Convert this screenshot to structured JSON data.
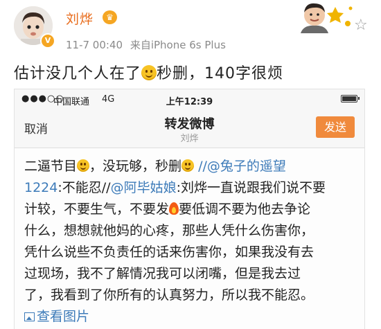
{
  "post": {
    "username": "刘烨",
    "timestamp": "11-7 00:40",
    "source": "来自iPhone 6s Plus",
    "headline_before": "估计没几个人在了",
    "headline_after": "秒删，140字很烦"
  },
  "statusbar": {
    "carrier": "中国联通",
    "network": "4G",
    "time": "上午12:39"
  },
  "navbar": {
    "cancel": "取消",
    "title": "转发微博",
    "subtitle": "刘烨",
    "send": "发送"
  },
  "repost": {
    "l1_a": "二逼节目",
    "l1_b": "，没玩够，秒删",
    "l1_link": "//@兔子的遥望",
    "l2_link1": "1224",
    "l2_a": ":不能忍//",
    "l2_link2": "@阿毕姑娘",
    "l2_b": ":刘烨一直说跟我们说不要",
    "l3_a": "计较，不要生气，不要发",
    "l3_b": "要低调不要为他去争论",
    "l4": "什么，想想就他妈的心疼，那些人凭什么伤害你，",
    "l5": "凭什么说些不负责任的话来伤害你，如果我没有去",
    "l6": "过现场，我不了解情况我可以闭嘴，但是我去过",
    "l7": "了，我看到了你所有的认真努力，所以我不能忍。",
    "view_pics": "查看图片"
  },
  "colors": {
    "username": "#e86c1c",
    "link": "#3d7bb9",
    "send_button": "#f08a3c",
    "badge": "#f5a623"
  },
  "icons": [
    "verified-badge-icon",
    "crown-icon",
    "star-icon",
    "smile-emoji-icon",
    "fire-emoji-icon",
    "picture-icon",
    "battery-icon",
    "signal-icon"
  ]
}
